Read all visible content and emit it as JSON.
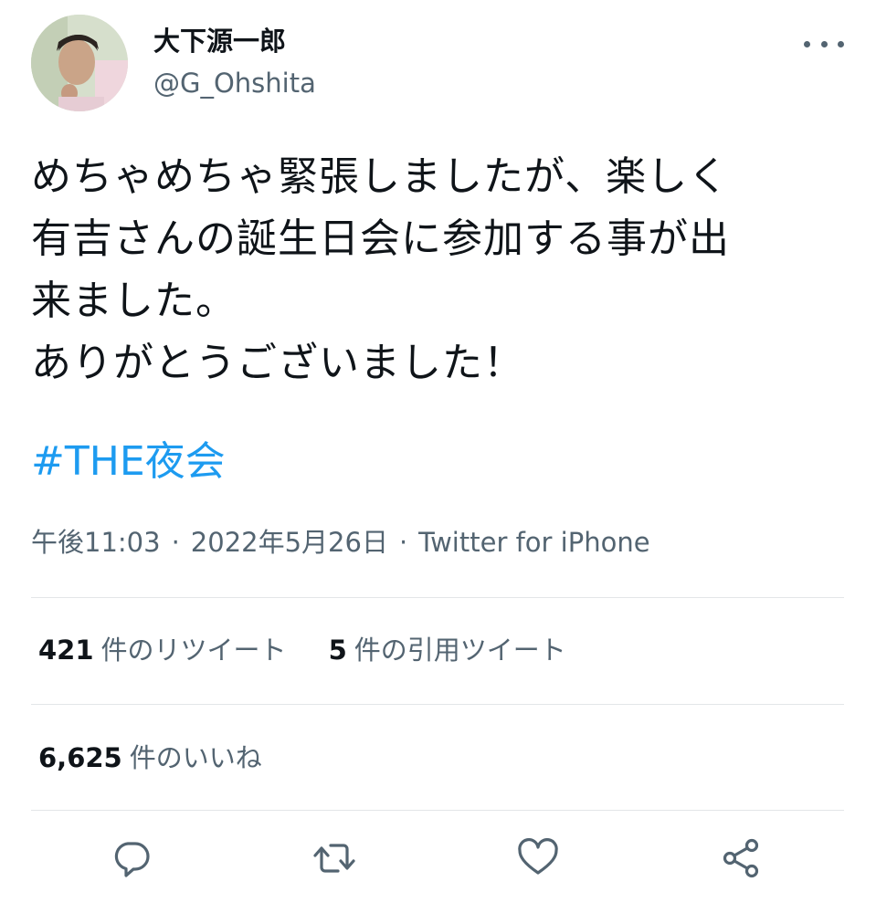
{
  "author": {
    "display_name": "大下源一郎",
    "handle": "@G_Ohshita",
    "avatar_icon": "avatar"
  },
  "tweet": {
    "text": "めちゃめちゃ緊張しましたが、楽しく\n有吉さんの誕生日会に参加する事が出\n来ました。\nありがとうございました！",
    "hashtag": "#THE夜会"
  },
  "meta": {
    "time": "午後11:03",
    "separator": "·",
    "date": "2022年5月26日",
    "source": "Twitter for iPhone"
  },
  "stats": {
    "retweets_count": "421",
    "retweets_label": "件のリツイート",
    "quotes_count": "5",
    "quotes_label": "件の引用ツイート",
    "likes_count": "6,625",
    "likes_label": "件のいいね"
  },
  "actions": {
    "reply_icon": "reply-icon",
    "retweet_icon": "retweet-icon",
    "like_icon": "heart-icon",
    "share_icon": "share-icon"
  },
  "colors": {
    "link": "#1d9bf0",
    "secondary_text": "#536471",
    "primary_text": "#0f1419",
    "divider": "#e3e6e8"
  }
}
